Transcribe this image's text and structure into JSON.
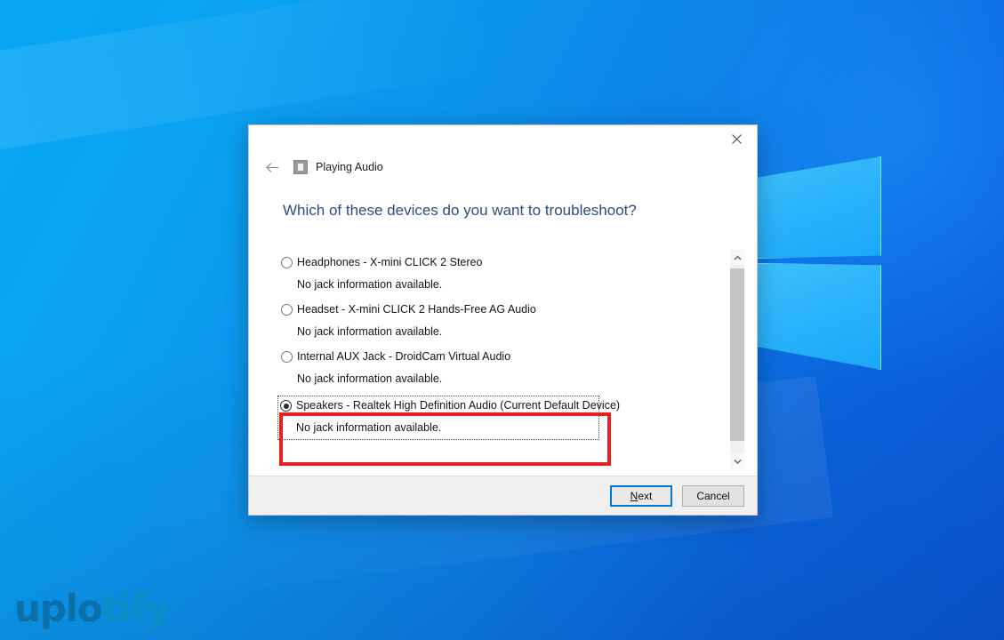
{
  "desktop": {
    "watermark": {
      "part1": "uplo",
      "part2": "tify"
    },
    "wallpaper_name": "windows-10-hero-wallpaper"
  },
  "dialog": {
    "close_label": "Close",
    "back_label": "Back",
    "icon_name": "troubleshooter-icon",
    "title": "Playing Audio",
    "heading": "Which of these devices do you want to troubleshoot?",
    "devices": [
      {
        "label": "Headphones - X-mini CLICK 2 Stereo",
        "note": "No jack information available.",
        "selected": false
      },
      {
        "label": "Headset - X-mini CLICK 2 Hands-Free AG Audio",
        "note": "No jack information available.",
        "selected": false
      },
      {
        "label": "Internal AUX Jack - DroidCam Virtual Audio",
        "note": "No jack information available.",
        "selected": false
      },
      {
        "label": "Speakers - Realtek High Definition Audio (Current Default Device)",
        "note": "No jack information available.",
        "selected": true
      }
    ],
    "scrollbar": {
      "up_label": "Scroll up",
      "down_label": "Scroll down"
    },
    "footer": {
      "next_accel": "N",
      "next_rest": "ext",
      "next_label": "Next",
      "cancel_label": "Cancel"
    },
    "annotation": {
      "color": "#e81f1f",
      "target": "Speakers - Realtek High Definition Audio (Current Default Device)"
    }
  }
}
